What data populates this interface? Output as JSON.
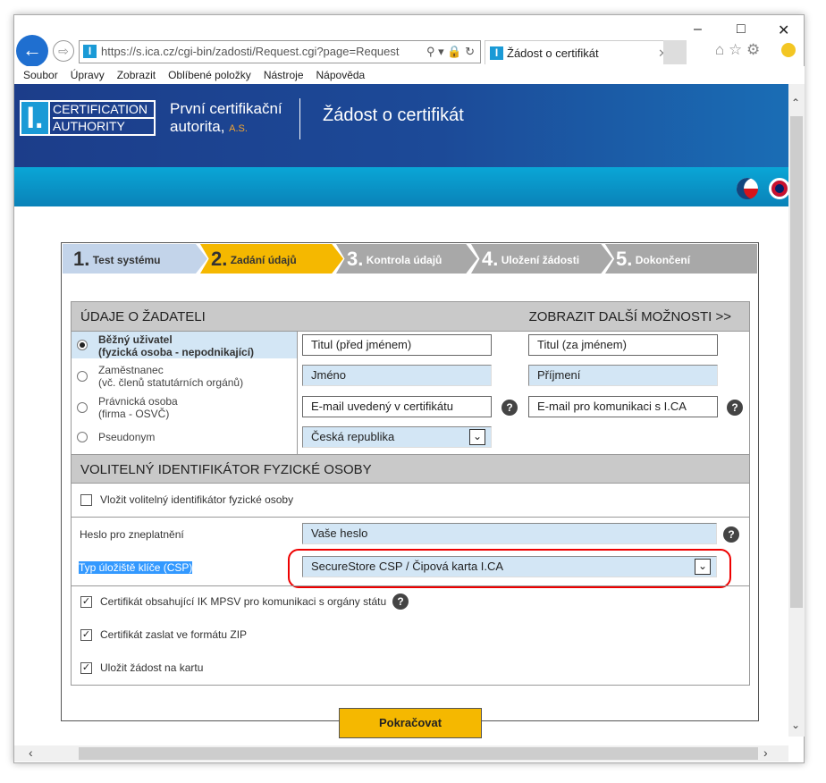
{
  "browser": {
    "url": "https://s.ica.cz/cgi-bin/zadosti/Request.cgi?page=Request",
    "tab_title": "Žádost o certifikát",
    "menu": [
      "Soubor",
      "Úpravy",
      "Zobrazit",
      "Oblíbené položky",
      "Nástroje",
      "Nápověda"
    ]
  },
  "banner": {
    "logo_top": "CERTIFICATION",
    "logo_bottom": "AUTHORITY",
    "company_line1": "První certifikační",
    "company_line2": "autorita",
    "company_suffix": "A.S.",
    "title": "Žádost o certifikát"
  },
  "steps": [
    {
      "num": "1.",
      "label": "Test systému"
    },
    {
      "num": "2.",
      "label": "Zadání údajů"
    },
    {
      "num": "3.",
      "label": "Kontrola údajů"
    },
    {
      "num": "4.",
      "label": "Uložení žádosti"
    },
    {
      "num": "5.",
      "label": "Dokončení"
    }
  ],
  "applicant": {
    "header": "ÚDAJE O ŽADATELI",
    "more": "ZOBRAZIT DALŠÍ MOŽNOSTI >>",
    "types": [
      {
        "l1": "Běžný uživatel",
        "l2": "(fyzická osoba - nepodnikající)"
      },
      {
        "l1": "Zaměstnanec",
        "l2": "(vč. členů statutárních orgánů)"
      },
      {
        "l1": "Právnická osoba",
        "l2": "(firma - OSVČ)"
      },
      {
        "l1": "Pseudonym",
        "l2": ""
      }
    ],
    "fields": {
      "title_before": "Titul (před jménem)",
      "title_after": "Titul (za jménem)",
      "first_name": "Jméno",
      "last_name": "Příjmení",
      "email_cert": "E-mail uvedený v certifikátu",
      "email_comm": "E-mail pro komunikaci s I.CA",
      "country": "Česká republika"
    }
  },
  "optional": {
    "header": "VOLITELNÝ IDENTIFIKÁTOR FYZICKÉ OSOBY",
    "checkbox": "Vložit volitelný identifikátor fyzické osoby"
  },
  "password": {
    "label": "Heslo pro zneplatnění",
    "value": "Vaše heslo"
  },
  "csp": {
    "label": "Typ úložiště klíče (CSP)",
    "value": "SecureStore CSP / Čipová karta I.CA"
  },
  "checks": [
    {
      "label": "Certifikát obsahující IK MPSV pro komunikaci s orgány státu",
      "checked": true
    },
    {
      "label": "Certifikát zaslat ve formátu ZIP",
      "checked": true
    },
    {
      "label": "Uložit žádost na kartu",
      "checked": true
    }
  ],
  "continue": "Pokračovat",
  "colors": {
    "active_step": "#f5b800",
    "done_step": "#c3d4ea",
    "todo_step": "#a8a8a8",
    "highlight": "#ee0000"
  }
}
